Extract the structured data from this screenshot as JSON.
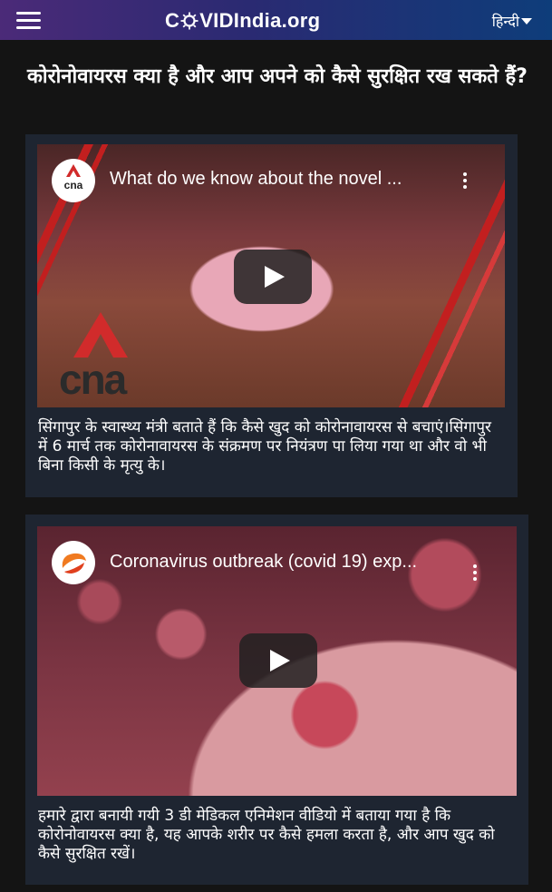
{
  "header": {
    "brand": "COVIDIndia.org",
    "brand_prefix": "C",
    "brand_suffix": "VIDIndia.org",
    "language": "हिन्दी"
  },
  "page": {
    "heading": "कोरोनोवायरस क्या है और आप अपने को कैसे सुरक्षित रख सकते हैं?"
  },
  "videos": [
    {
      "channel": "cna",
      "title": "What do we know about the novel ...",
      "watermark": "cna",
      "description": "सिंगापुर के स्वास्थ्य मंत्री बताते हैं कि कैसे खुद को कोरोनावायरस से बचाएं।सिंगापुर में 6 मार्च तक कोरोनावायरस के संक्रमण पर नियंत्रण पा लिया गया था और वो भी बिना किसी के मृत्यु के।"
    },
    {
      "channel": "",
      "title": "Coronavirus outbreak (covid 19) exp...",
      "description": "हमारे द्वारा बनायी गयी 3 डी मेडिकल एनिमेशन वीडियो में बताया गया है कि कोरोनोवायरस क्या है, यह आपके शरीर पर कैसे हमला करता है, और आप खुद को कैसे सुरक्षित रखें।"
    }
  ],
  "colors": {
    "background": "#141414",
    "card": "#1e2531",
    "accent_red": "#c21f1f"
  }
}
